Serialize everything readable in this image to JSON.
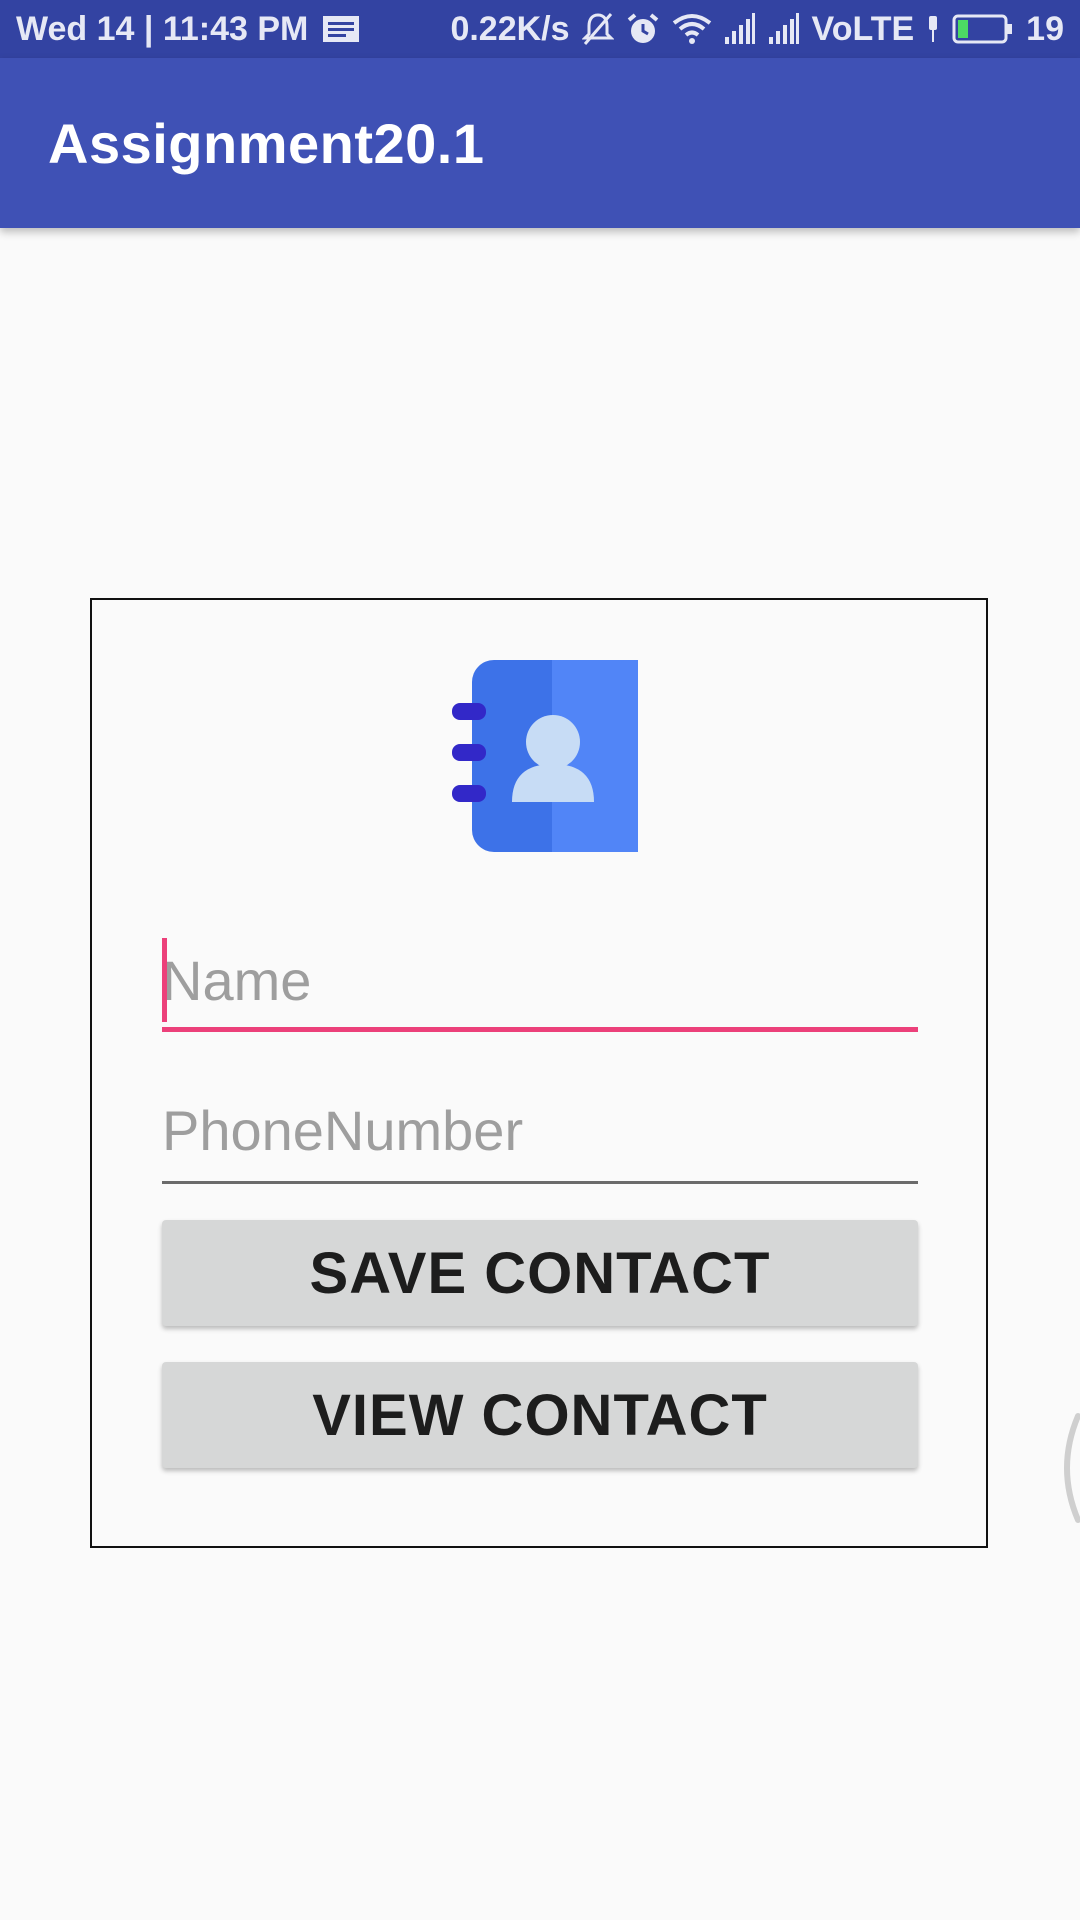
{
  "status_bar": {
    "datetime": "Wed 14 | 11:43 PM",
    "net_speed": "0.22K/s",
    "network_type": "VoLTE",
    "battery": "19",
    "icons": [
      "notification-icon",
      "mute-icon",
      "alarm-icon",
      "wifi-icon",
      "signal-icon",
      "signal-icon",
      "charging-icon",
      "battery-icon"
    ]
  },
  "app_bar": {
    "title": "Assignment20.1"
  },
  "form": {
    "logo_icon": "contact-book-icon",
    "name_placeholder": "Name",
    "name_value": "",
    "phone_placeholder": "PhoneNumber",
    "phone_value": "",
    "save_label": "SAVE CONTACT",
    "view_label": "VIEW CONTACT"
  },
  "colors": {
    "status_bar": "#3343a2",
    "app_bar": "#3f51b5",
    "accent": "#ec407a",
    "button_bg": "#d6d7d7",
    "contact_icon_blue": "#5185f7"
  }
}
